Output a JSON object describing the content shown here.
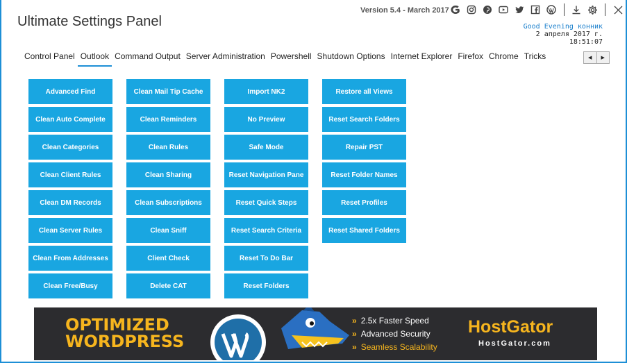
{
  "app": {
    "title": "Ultimate Settings Panel",
    "version": "Version 5.4 - March 2017"
  },
  "header": {
    "greeting": "Good Evening конник",
    "date": "2 апреля 2017 г.",
    "time": "18:51:07"
  },
  "tabs": [
    {
      "label": "Control Panel"
    },
    {
      "label": "Outlook",
      "active": true
    },
    {
      "label": "Command Output"
    },
    {
      "label": "Server Administration"
    },
    {
      "label": "Powershell"
    },
    {
      "label": "Shutdown Options"
    },
    {
      "label": "Internet Explorer"
    },
    {
      "label": "Firefox"
    },
    {
      "label": "Chrome"
    },
    {
      "label": "Tricks"
    }
  ],
  "buttons": {
    "col1": [
      "Advanced Find",
      "Clean Auto Complete",
      "Clean Categories",
      "Clean Client Rules",
      "Clean DM Records",
      "Clean Server Rules",
      "Clean From Addresses",
      "Clean Free/Busy"
    ],
    "col2": [
      "Clean Mail Tip Cache",
      "Clean Reminders",
      "Clean Rules",
      "Clean Sharing",
      "Clean Subscriptions",
      "Clean Sniff",
      "Client Check",
      "Delete CAT"
    ],
    "col3": [
      "Import NK2",
      "No Preview",
      "Safe Mode",
      "Reset Navigation Pane",
      "Reset Quick Steps",
      "Reset Search Criteria",
      "Reset To Do Bar",
      "Reset Folders"
    ],
    "col4": [
      "Restore all Views",
      "Reset Search Folders",
      "Repair PST",
      "Reset Folder Names",
      "Reset Profiles",
      "Reset Shared Folders"
    ]
  },
  "banner": {
    "headline_line1": "OPTIMIZED",
    "headline_line2": "WORDPRESS",
    "feature1": "2.5x Faster Speed",
    "feature2": "Advanced Security",
    "feature3": "Seamless Scalability",
    "brand": "HostGator",
    "brand_url": "HostGator.com"
  },
  "colors": {
    "accent": "#1d8fd6",
    "button_bg": "#19a6e1",
    "banner_bg": "#2c2c2f",
    "banner_gold": "#f6b51e"
  }
}
